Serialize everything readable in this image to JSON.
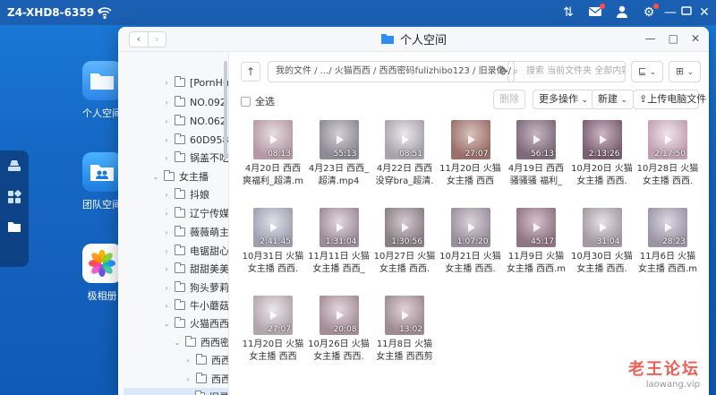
{
  "device": {
    "name": "Z4-XHD8-6359"
  },
  "desktop": {
    "apps": [
      {
        "label": "个人空间"
      },
      {
        "label": "团队空间"
      },
      {
        "label": "极相册"
      }
    ]
  },
  "window": {
    "title": "个人空间",
    "path": "我的文件 / .../ 火猫西西 / 西西密码fulizhibo123 / 旧录像 /",
    "search_placeholder": "搜索 当前文件夹 全部内容"
  },
  "sidebar": {
    "items": [
      {
        "label": "[PornHul"
      },
      {
        "label": "NO.092 J"
      },
      {
        "label": "NO.062 J"
      },
      {
        "label": "60D9582"
      },
      {
        "label": "锅盖不吃"
      },
      {
        "label": "女主播"
      },
      {
        "label": "抖娘"
      },
      {
        "label": "辽宁传媒"
      },
      {
        "label": "薇薇萌主"
      },
      {
        "label": "电锯甜心"
      },
      {
        "label": "甜甜美美"
      },
      {
        "label": "狗头萝莉"
      },
      {
        "label": "牛小蘑菇"
      },
      {
        "label": "火猫西西"
      },
      {
        "label": "西西密"
      },
      {
        "label": "西西"
      },
      {
        "label": "西西"
      },
      {
        "label": "旧录"
      }
    ]
  },
  "toolbar": {
    "select_all": "全选",
    "delete": "删除",
    "more": "更多操作",
    "new": "新建",
    "upload": "上传电脑文件"
  },
  "files": [
    {
      "name": "4月20日 西西 爽福利_超清.mp4",
      "duration": "08:13"
    },
    {
      "name": "4月23日 西西_超清.mp4",
      "duration": "55:13"
    },
    {
      "name": "4月22日 西西 没穿bra_超清.mp4",
      "duration": "08:51"
    },
    {
      "name": "11月20日 火猫女主播 西西 剪...",
      "duration": "27:07"
    },
    {
      "name": "4月19日 西西 骚骚骚 福利_超...",
      "duration": "56:13"
    },
    {
      "name": "10月20日 火猫女主播 西西.m...",
      "duration": "2:13:26"
    },
    {
      "name": "10月28日 火猫女主播 西西.m...",
      "duration": "2:17:50"
    },
    {
      "name": "10月31日 火猫女主播 西西.m...",
      "duration": "2:41:45"
    },
    {
      "name": "11月11日 火猫女主播 西西_0...",
      "duration": "1:31:04"
    },
    {
      "name": "10月27日 火猫女主播 西西.m...",
      "duration": "1:30:56"
    },
    {
      "name": "10月21日 火猫女主播 西西.m...",
      "duration": "1:07:20"
    },
    {
      "name": "11月9日 火猫女主播 西西.mp4",
      "duration": "45:17"
    },
    {
      "name": "10月30日 火猫女主播 西西.m...",
      "duration": "31:04"
    },
    {
      "name": "11月6日 火猫女主播 西西.mp4",
      "duration": "28:23"
    },
    {
      "name": "11月20日 火猫女主播 西西 剪...",
      "duration": "27:07"
    },
    {
      "name": "10月26日 火猫女主播 西西.m...",
      "duration": "20:08"
    },
    {
      "name": "11月8日 火猫女主播 西西剪辑....",
      "duration": "13:02"
    }
  ],
  "watermark": {
    "line1": "老王论坛",
    "line2": "laowang.vip"
  },
  "colors": {
    "accent": "#1677ff",
    "desktop": "#1667c4"
  }
}
